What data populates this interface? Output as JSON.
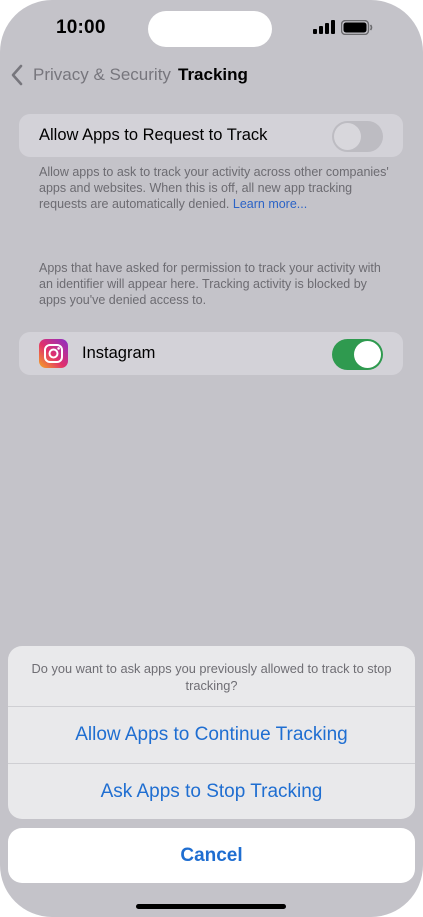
{
  "status_bar": {
    "time": "10:00",
    "icons": [
      "signal-icon",
      "battery-icon"
    ]
  },
  "nav": {
    "back_label": "Privacy & Security",
    "title": "Tracking",
    "back_icon": "chevron-left-icon"
  },
  "allow_tracking": {
    "label": "Allow Apps to Request to Track",
    "enabled": false,
    "description": "Allow apps to ask to track your activity across other companies' apps and websites. When this is off, all new app tracking requests are automatically denied.",
    "learn_more": "Learn more..."
  },
  "apps_info": "Apps that have asked for permission to track your activity with an identifier will appear here. Tracking activity is blocked by apps you've denied access to.",
  "apps": [
    {
      "name": "Instagram",
      "icon": "instagram-icon",
      "enabled": true
    }
  ],
  "action_sheet": {
    "message": "Do you want to ask apps you previously allowed to track to stop tracking?",
    "actions": [
      "Allow Apps to Continue Tracking",
      "Ask Apps to Stop Tracking"
    ],
    "cancel": "Cancel"
  },
  "colors": {
    "accent": "#1f6ed1",
    "toggle_on": "#2f9a4f",
    "link": "#2b63c6"
  }
}
